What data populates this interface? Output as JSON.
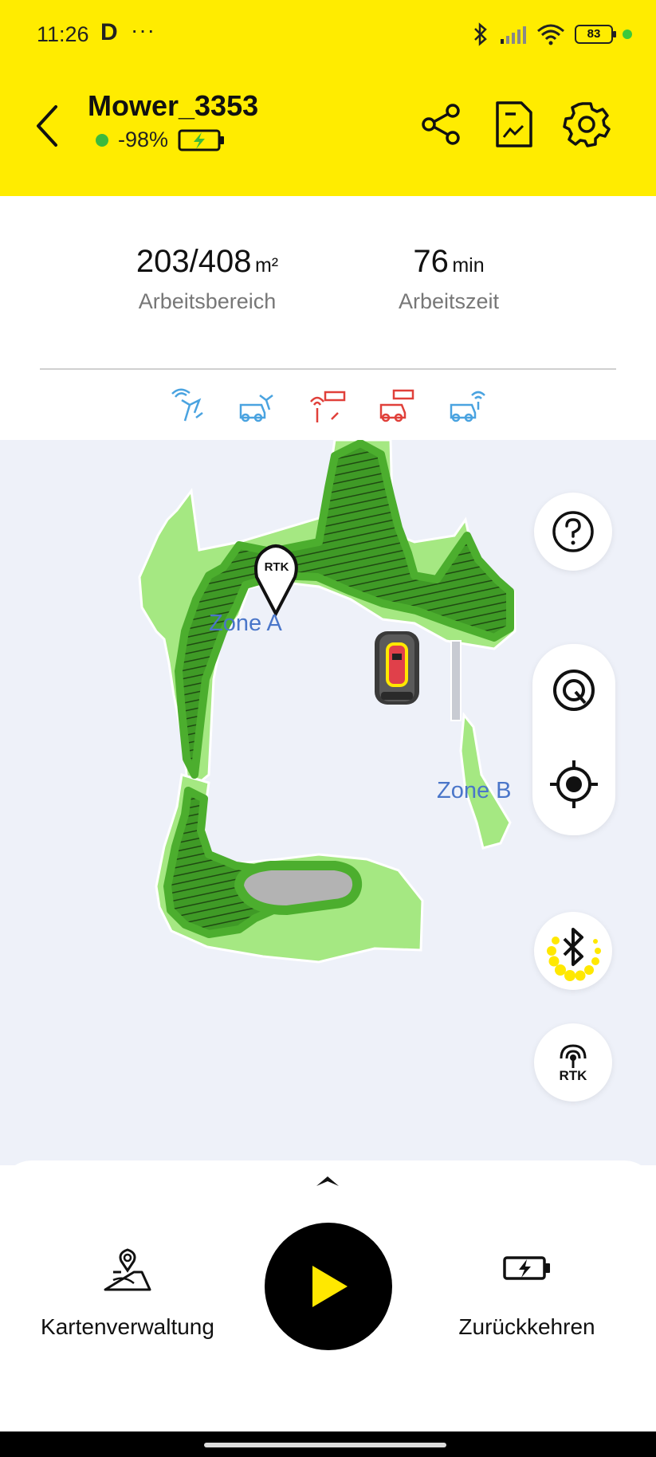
{
  "status_bar": {
    "time": "11:26",
    "battery": "83",
    "icons": [
      "d-app-icon",
      "more-dots-icon",
      "bluetooth-icon",
      "cell-signal-icon",
      "wifi-icon",
      "battery-icon"
    ]
  },
  "header": {
    "title": "Mower_3353",
    "signal": "-98%",
    "status_color": "#3cba3c",
    "background": "#ffec00"
  },
  "stats": {
    "area_value": "203/408",
    "area_unit": "m²",
    "area_label": "Arbeitsbereich",
    "time_value": "76",
    "time_unit": "min",
    "time_label": "Arbeitszeit"
  },
  "signal_icons": [
    {
      "name": "rtk-station-signal-ok",
      "color": "#4aa3e0"
    },
    {
      "name": "mower-rtk-signal-ok",
      "color": "#4aa3e0"
    },
    {
      "name": "station-network-error",
      "color": "#e0403a"
    },
    {
      "name": "mower-network-error",
      "color": "#e0403a"
    },
    {
      "name": "mower-wifi-signal-ok",
      "color": "#4aa3e0"
    }
  ],
  "map": {
    "zone_a": "Zone A",
    "zone_b": "Zone B",
    "rtk_marker": "RTK",
    "rtk_button": "RTK"
  },
  "bottom": {
    "map_mgmt": "Kartenverwaltung",
    "return_home": "Zurückkehren"
  }
}
